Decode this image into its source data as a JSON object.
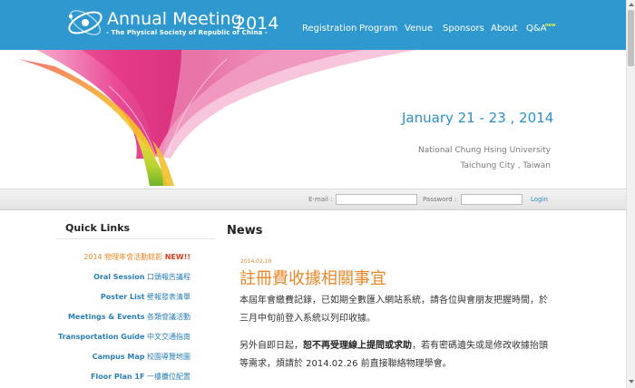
{
  "header": {
    "title": "Annual Meeting",
    "year": "2014",
    "subtitle": "- The Physical Society of Republic of China -",
    "nav": [
      "Registration",
      "Program",
      "Venue",
      "Sponsors",
      "About",
      "Q&A"
    ],
    "new_tag": "new"
  },
  "banner": {
    "date": "January 21 - 23 , 2014",
    "university": "National Chung Hsing University",
    "city": "Taichung City , Taiwan"
  },
  "login": {
    "email_label": "E-mail :",
    "password_label": "Password :",
    "login_label": "Login"
  },
  "quick_links": {
    "title": "Quick Links",
    "highlight": {
      "zh": "2014 物理年會活動餘影",
      "new": "NEW!!"
    },
    "items": [
      {
        "en": "Oral Session",
        "zh": "口頭報告議程"
      },
      {
        "en": "Poster List",
        "zh": "壁報發表清單"
      },
      {
        "en": "Meetings & Events",
        "zh": "各類會議活動"
      },
      {
        "en": "Transportation Guide",
        "zh": "中文交通指南"
      },
      {
        "en": "Campus Map",
        "zh": "校園導覽地圖"
      },
      {
        "en": "Floor Plan 1F",
        "zh": "一樓攤位配置"
      }
    ]
  },
  "news": {
    "title": "News",
    "date": "2014.02.19",
    "headline": "註冊費收據相關事宜",
    "para1": "本屆年會繳費記錄，已如期全數匯入網站系統，請各位與會朋友把握時間，於三月中旬前登入系統以列印收據。",
    "para2_pre": "另外自即日起，",
    "para2_bold": "恕不再受理線上提問或求助",
    "para2_post": "，若有密碼遺失或是修改收據抬頭等需求，煩請於 2014.02.26 前直接聯絡物理學會。"
  },
  "colors": {
    "header_bg": "#2f99cf",
    "accent_orange": "#e8882a",
    "link_blue": "#2a7fb5",
    "new_red": "#e23b20"
  }
}
